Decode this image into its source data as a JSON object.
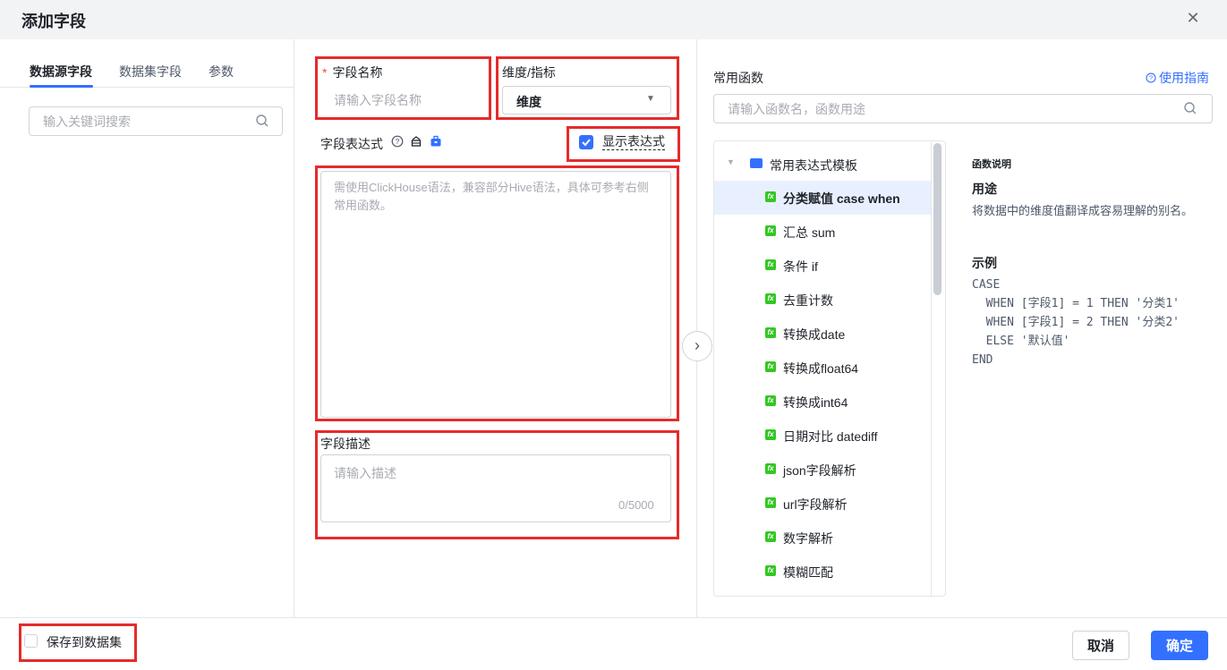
{
  "dialog": {
    "title": "添加字段",
    "close_icon": "close-icon"
  },
  "left": {
    "tabs": [
      {
        "label": "数据源字段"
      },
      {
        "label": "数据集字段"
      },
      {
        "label": "参数"
      }
    ],
    "search_placeholder": "输入关键词搜索"
  },
  "form": {
    "required_mark": "*",
    "name_label": "字段名称",
    "name_placeholder": "请输入字段名称",
    "type_label": "维度/指标",
    "type_value": "维度",
    "expr_label": "字段表达式",
    "show_expr_label": "显示表达式",
    "show_expr_checked": true,
    "expr_placeholder": "需使用ClickHouse语法，兼容部分Hive语法，具体可参考右侧常用函数。",
    "desc_label": "字段描述",
    "desc_placeholder": "请输入描述",
    "desc_counter": "0/5000"
  },
  "functions": {
    "title": "常用函数",
    "guide_label": "使用指南",
    "search_placeholder": "请输入函数名，函数用途",
    "tree_root": "常用表达式模板",
    "items": [
      {
        "label": "分类赋值 case when"
      },
      {
        "label": "汇总 sum"
      },
      {
        "label": "条件 if"
      },
      {
        "label": "去重计数"
      },
      {
        "label": "转换成date"
      },
      {
        "label": "转换成float64"
      },
      {
        "label": "转换成int64"
      },
      {
        "label": "日期对比 datediff"
      },
      {
        "label": "json字段解析"
      },
      {
        "label": "url字段解析"
      },
      {
        "label": "数字解析"
      },
      {
        "label": "模糊匹配"
      }
    ],
    "selected_index": 0,
    "doc": {
      "title": "函数说明",
      "usage_heading": "用途",
      "usage_text": "将数据中的维度值翻译成容易理解的别名。",
      "example_heading": "示例",
      "example_code": "CASE\n  WHEN [字段1] = 1 THEN '分类1'\n  WHEN [字段1] = 2 THEN '分类2'\n  ELSE '默认值'\nEND"
    }
  },
  "footer": {
    "save_label": "保存到数据集",
    "cancel_label": "取消",
    "ok_label": "确定"
  },
  "colors": {
    "accent": "#3370ff",
    "highlight": "#e52b2b",
    "fx_green": "#34c724"
  }
}
